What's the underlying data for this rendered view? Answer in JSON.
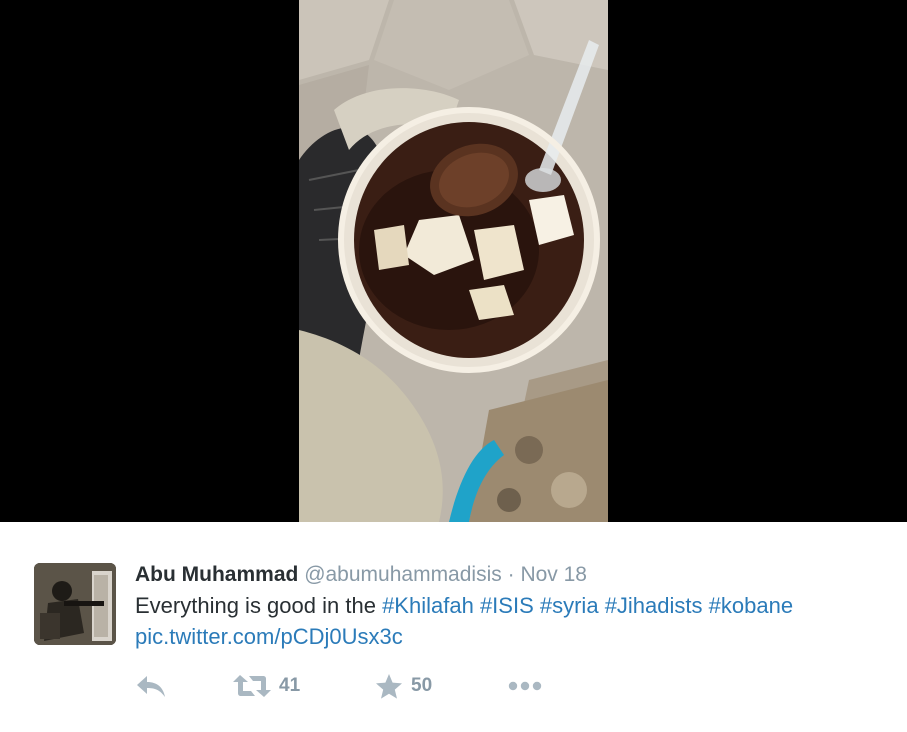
{
  "media": {
    "background_color": "#000000",
    "photo_description_icon": "photo-icon"
  },
  "tweet": {
    "display_name": "Abu Muhammad",
    "handle": "@abumuhammadisis",
    "separator": "·",
    "date": "Nov 18",
    "text_prefix": "Everything is good in the",
    "hashtags": [
      "#Khilafah",
      "#ISIS",
      "#syria",
      "#Jihadists",
      "#kobane"
    ],
    "link": "pic.twitter.com/pCDj0Usx3c"
  },
  "actions": {
    "reply_icon": "reply-icon",
    "retweet_icon": "retweet-icon",
    "retweet_count": "41",
    "favorite_icon": "star-icon",
    "favorite_count": "50",
    "more_icon": "more-icon"
  },
  "colors": {
    "link": "#2b7bb9",
    "name": "#292f33",
    "meta": "#8899a6",
    "icon": "#aab8c2"
  }
}
